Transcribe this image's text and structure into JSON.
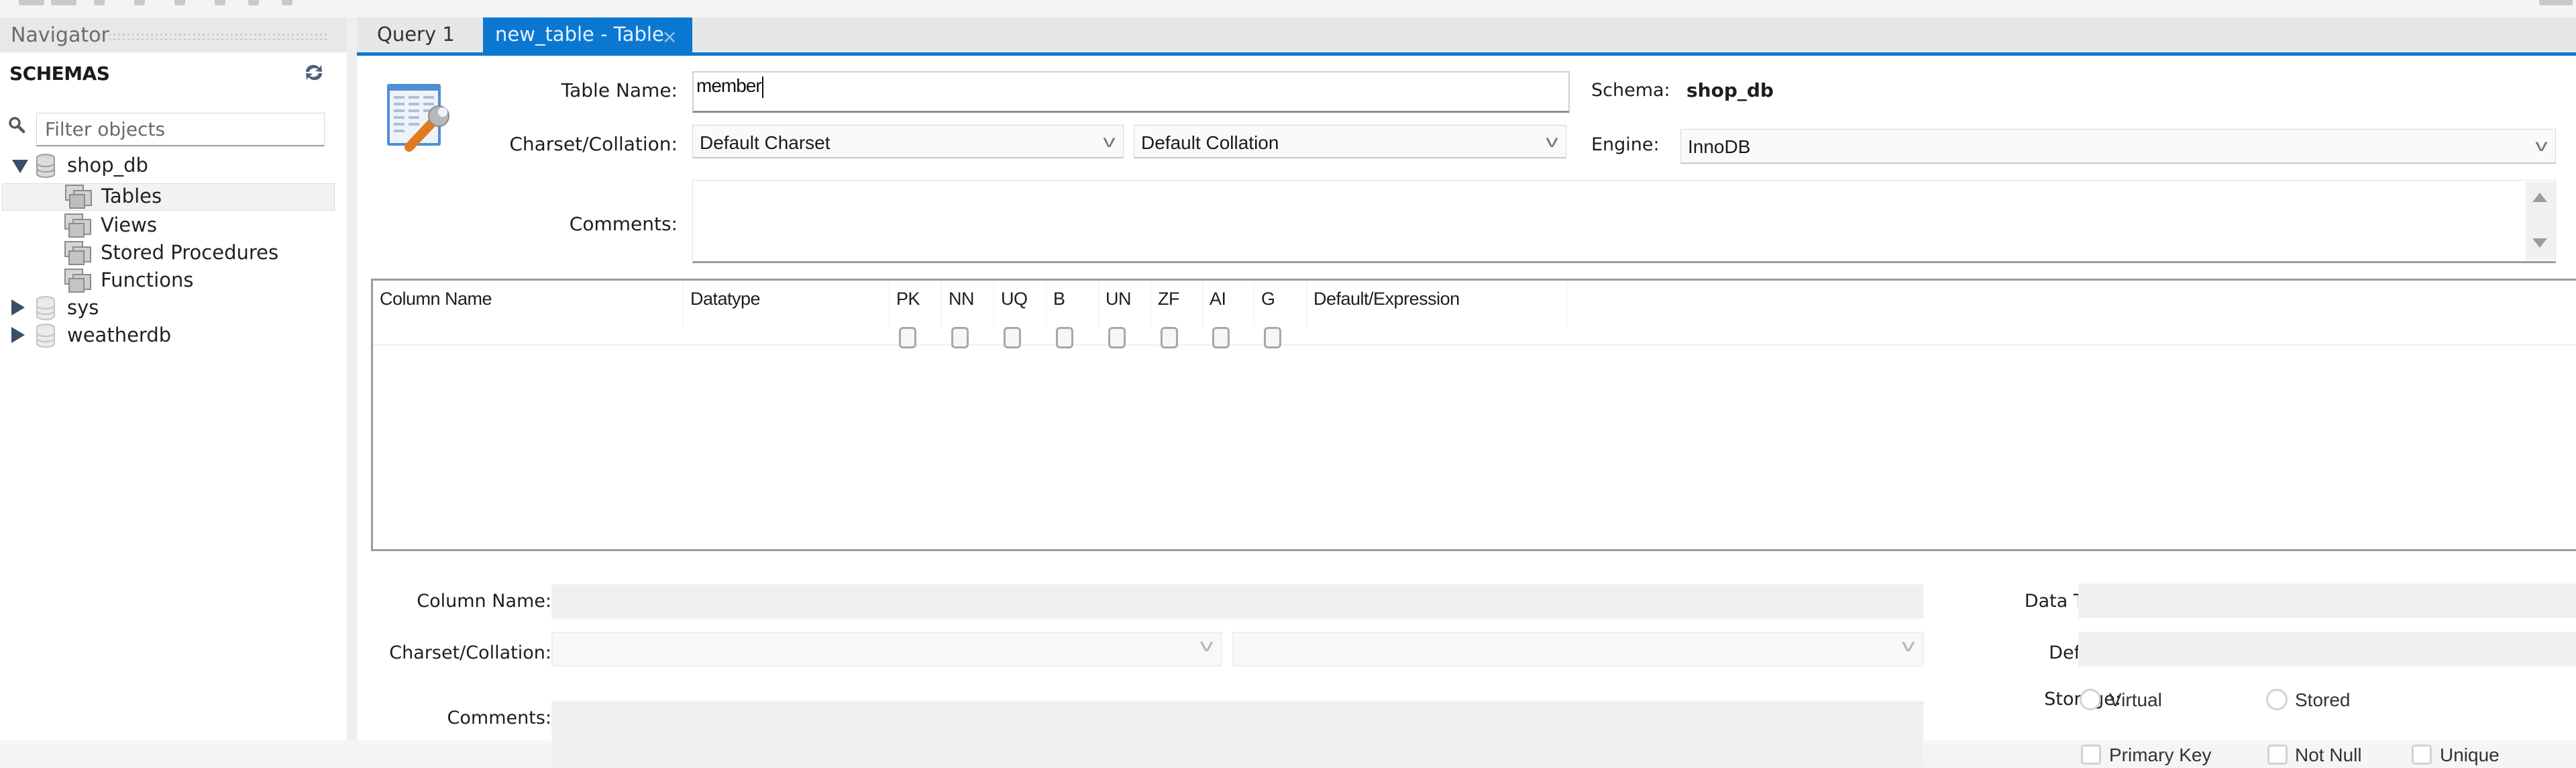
{
  "navigator": {
    "title": "Navigator",
    "schemas_title": "SCHEMAS",
    "filter_placeholder": "Filter objects",
    "tree": [
      {
        "label": "shop_db",
        "expanded": true
      },
      {
        "label": "Tables",
        "selected": true
      },
      {
        "label": "Views"
      },
      {
        "label": "Stored Procedures"
      },
      {
        "label": "Functions"
      },
      {
        "label": "sys",
        "expanded": false
      },
      {
        "label": "weatherdb",
        "expanded": false
      }
    ]
  },
  "tabs": [
    {
      "label": "Query 1",
      "active": false
    },
    {
      "label": "new_table - Table",
      "active": true,
      "close": "×"
    }
  ],
  "editor": {
    "table_name_label": "Table Name:",
    "table_name_value": "member",
    "charset_label": "Charset/Collation:",
    "charset_value": "Default Charset",
    "collation_value": "Default Collation",
    "schema_label": "Schema:",
    "schema_value": "shop_db",
    "engine_label": "Engine:",
    "engine_value": "InnoDB",
    "comments_label": "Comments:",
    "comments_value": ""
  },
  "grid": {
    "columns": [
      "Column Name",
      "Datatype",
      "PK",
      "NN",
      "UQ",
      "B",
      "UN",
      "ZF",
      "AI",
      "G",
      "Default/Expression"
    ],
    "flag_columns": [
      "PK",
      "NN",
      "UQ",
      "B",
      "UN",
      "ZF",
      "AI",
      "G"
    ],
    "flags_checked": [
      false,
      false,
      false,
      false,
      false,
      false,
      false,
      false
    ],
    "rows": []
  },
  "column_details": {
    "column_name_label": "Column Name:",
    "column_name_value": "",
    "charset_label": "Charset/Collation:",
    "comments_label": "Comments:",
    "data_type_label": "Data Type:",
    "default_label": "Default:",
    "storage_label": "Storage:",
    "storage_options": [
      "Virtual",
      "Stored"
    ],
    "flag_options": [
      "Primary Key",
      "Not Null",
      "Unique"
    ]
  },
  "colors": {
    "accent": "#0a78d1",
    "tab_bar": "#e7e7e7",
    "navigator_header": "#e8e8e8",
    "disabled_field": "#efefef"
  }
}
